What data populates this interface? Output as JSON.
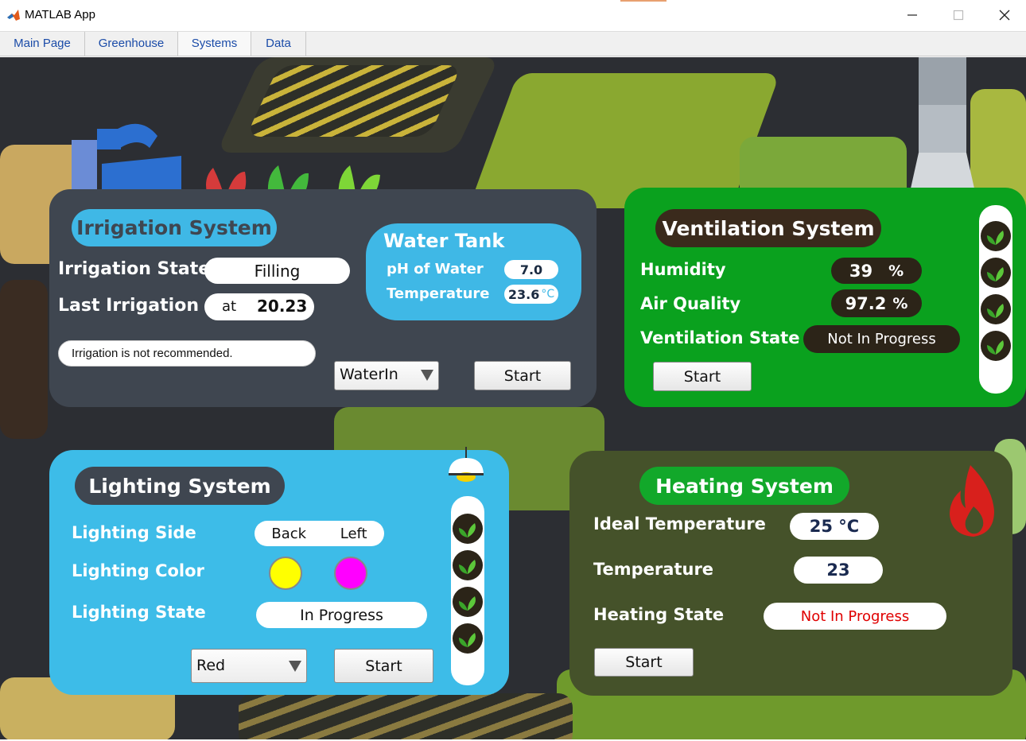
{
  "window": {
    "title": "MATLAB App",
    "icon": "matlab-logo-icon",
    "controls": {
      "minimize": "—",
      "maximize": "☐",
      "close": "✕"
    }
  },
  "tabs": [
    {
      "label": "Main Page"
    },
    {
      "label": "Greenhouse"
    },
    {
      "label": "Systems",
      "active": true
    },
    {
      "label": "Data"
    }
  ],
  "irrigation": {
    "title": "Irrigation System",
    "state_label": "Irrigation State",
    "state_value": "Filling",
    "last_label": "Last Irrigation",
    "last_prefix": "at",
    "last_value": "20.23",
    "message": "Irrigation is not recommended.",
    "dropdown_value": "WaterIn",
    "start_label": "Start",
    "water_tank": {
      "title": "Water Tank",
      "ph_label": "pH of Water",
      "ph_value": "7.0",
      "temp_label": "Temperature",
      "temp_value": "23.6",
      "temp_unit": "°C"
    }
  },
  "ventilation": {
    "title": "Ventilation System",
    "humidity_label": "Humidity",
    "humidity_value": "39",
    "humidity_unit": "%",
    "air_label": "Air Quality",
    "air_value": "97.2",
    "air_unit": "%",
    "state_label": "Ventilation State",
    "state_value": "Not In Progress",
    "start_label": "Start"
  },
  "lighting": {
    "title": "Lighting System",
    "side_label": "Lighting Side",
    "side_values": [
      "Back",
      "Left"
    ],
    "color_label": "Lighting Color",
    "color_swatches": [
      "#ffff00",
      "#ff00ff"
    ],
    "state_label": "Lighting State",
    "state_value": "In Progress",
    "dropdown_value": "Red",
    "start_label": "Start"
  },
  "heating": {
    "title": "Heating System",
    "ideal_label": "Ideal Temperature",
    "ideal_value": "25 °C",
    "temp_label": "Temperature",
    "temp_value": "23",
    "state_label": "Heating State",
    "state_value": "Not In Progress",
    "start_label": "Start"
  },
  "colors": {
    "irrigation_panel": "#3f4650",
    "irrigation_accent": "#3fb8e6",
    "ventilation_panel": "#0aa11e",
    "ventilation_pill": "#3a2a1c",
    "lighting_panel": "#3dbce8",
    "lighting_title": "#3f4650",
    "heating_panel": "#45522a",
    "heating_title": "#12a82a",
    "alert_red": "#e00000"
  }
}
